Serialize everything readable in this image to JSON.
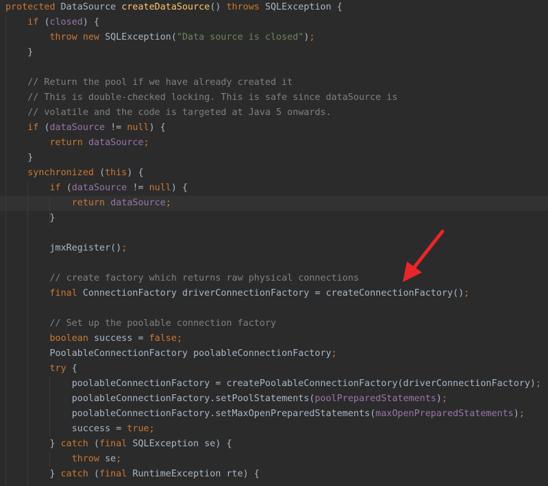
{
  "editor": {
    "lines": [
      [
        {
          "t": "protected ",
          "c": "kw"
        },
        {
          "t": "DataSource ",
          "c": ""
        },
        {
          "t": "createDataSource",
          "c": "fn"
        },
        {
          "t": "() ",
          "c": ""
        },
        {
          "t": "throws ",
          "c": "kw"
        },
        {
          "t": "SQLException {",
          "c": ""
        }
      ],
      [
        {
          "t": "    if ",
          "c": "kw"
        },
        {
          "t": "(",
          "c": ""
        },
        {
          "t": "closed",
          "c": "fld"
        },
        {
          "t": ") {",
          "c": ""
        }
      ],
      [
        {
          "t": "        throw new ",
          "c": "kw"
        },
        {
          "t": "SQLException(",
          "c": ""
        },
        {
          "t": "\"Data source is closed\"",
          "c": "str"
        },
        {
          "t": ")",
          "c": ""
        },
        {
          "t": ";",
          "c": "kw"
        }
      ],
      [
        {
          "t": "    }",
          "c": ""
        }
      ],
      [],
      [
        {
          "t": "    // Return the pool if we have already created it",
          "c": "cmt"
        }
      ],
      [
        {
          "t": "    // This is double-checked locking. This is safe since dataSource is",
          "c": "cmt"
        }
      ],
      [
        {
          "t": "    // volatile and the code is targeted at Java 5 onwards.",
          "c": "cmt"
        }
      ],
      [
        {
          "t": "    if ",
          "c": "kw"
        },
        {
          "t": "(",
          "c": ""
        },
        {
          "t": "dataSource ",
          "c": "fld"
        },
        {
          "t": "!= ",
          "c": ""
        },
        {
          "t": "null",
          "c": "kw"
        },
        {
          "t": ") {",
          "c": ""
        }
      ],
      [
        {
          "t": "        return ",
          "c": "kw"
        },
        {
          "t": "dataSource",
          "c": "fld"
        },
        {
          "t": ";",
          "c": "kw"
        }
      ],
      [
        {
          "t": "    }",
          "c": ""
        }
      ],
      [
        {
          "t": "    synchronized ",
          "c": "kw"
        },
        {
          "t": "(",
          "c": ""
        },
        {
          "t": "this",
          "c": "kw"
        },
        {
          "t": ") {",
          "c": ""
        }
      ],
      [
        {
          "t": "        if ",
          "c": "kw"
        },
        {
          "t": "(",
          "c": ""
        },
        {
          "t": "dataSource ",
          "c": "fld"
        },
        {
          "t": "!= ",
          "c": ""
        },
        {
          "t": "null",
          "c": "kw"
        },
        {
          "t": ") {",
          "c": ""
        }
      ],
      [
        {
          "t": "            return ",
          "c": "kw"
        },
        {
          "t": "dataSource",
          "c": "fld"
        },
        {
          "t": ";",
          "c": "kw"
        }
      ],
      [
        {
          "t": "        }",
          "c": ""
        }
      ],
      [],
      [
        {
          "t": "        jmxRegister()",
          "c": ""
        },
        {
          "t": ";",
          "c": "kw"
        }
      ],
      [],
      [
        {
          "t": "        // create factory which returns raw physical connections",
          "c": "cmt"
        }
      ],
      [
        {
          "t": "        final ",
          "c": "kw"
        },
        {
          "t": "ConnectionFactory driverConnectionFactory = createConnectionFactory()",
          "c": ""
        },
        {
          "t": ";",
          "c": "kw"
        }
      ],
      [],
      [
        {
          "t": "        // Set up the poolable connection factory",
          "c": "cmt"
        }
      ],
      [
        {
          "t": "        boolean ",
          "c": "kw"
        },
        {
          "t": "success = ",
          "c": ""
        },
        {
          "t": "false",
          "c": "kw"
        },
        {
          "t": ";",
          "c": "kw"
        }
      ],
      [
        {
          "t": "        PoolableConnectionFactory poolableConnectionFactory",
          "c": ""
        },
        {
          "t": ";",
          "c": "kw"
        }
      ],
      [
        {
          "t": "        try ",
          "c": "kw"
        },
        {
          "t": "{",
          "c": ""
        }
      ],
      [
        {
          "t": "            poolableConnectionFactory = createPoolableConnectionFactory(driverConnectionFactory)",
          "c": ""
        },
        {
          "t": ";",
          "c": "kw"
        }
      ],
      [
        {
          "t": "            poolableConnectionFactory.setPoolStatements(",
          "c": ""
        },
        {
          "t": "poolPreparedStatements",
          "c": "fld"
        },
        {
          "t": ")",
          "c": ""
        },
        {
          "t": ";",
          "c": "kw"
        }
      ],
      [
        {
          "t": "            poolableConnectionFactory.setMaxOpenPreparedStatements(",
          "c": ""
        },
        {
          "t": "maxOpenPreparedStatements",
          "c": "fld"
        },
        {
          "t": ")",
          "c": ""
        },
        {
          "t": ";",
          "c": "kw"
        }
      ],
      [
        {
          "t": "            success = ",
          "c": ""
        },
        {
          "t": "true",
          "c": "kw"
        },
        {
          "t": ";",
          "c": "kw"
        }
      ],
      [
        {
          "t": "        } ",
          "c": ""
        },
        {
          "t": "catch ",
          "c": "kw"
        },
        {
          "t": "(",
          "c": ""
        },
        {
          "t": "final ",
          "c": "kw"
        },
        {
          "t": "SQLException se) {",
          "c": ""
        }
      ],
      [
        {
          "t": "            throw ",
          "c": "kw"
        },
        {
          "t": "se",
          "c": ""
        },
        {
          "t": ";",
          "c": "kw"
        }
      ],
      [
        {
          "t": "        } ",
          "c": ""
        },
        {
          "t": "catch ",
          "c": "kw"
        },
        {
          "t": "(",
          "c": ""
        },
        {
          "t": "final ",
          "c": "kw"
        },
        {
          "t": "RuntimeException rte) {",
          "c": ""
        }
      ]
    ],
    "current_line_index": 13
  },
  "annotation": {
    "arrow_color": "#e8262a"
  },
  "theme": {
    "background": "#2b2b2b",
    "keyword": "#cc7832",
    "field": "#9876aa",
    "function": "#ffc66d",
    "string": "#6a8759",
    "comment": "#808080",
    "text": "#a9b7c6"
  }
}
